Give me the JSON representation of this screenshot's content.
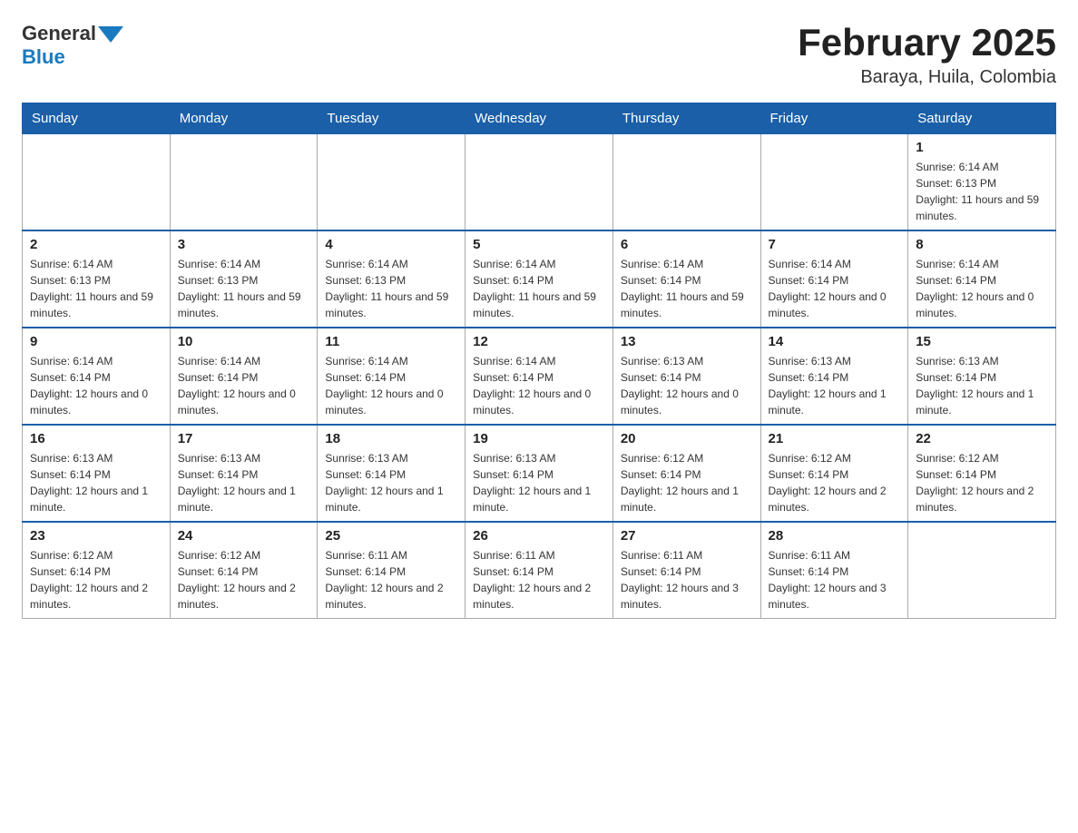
{
  "header": {
    "logo": {
      "general": "General",
      "blue": "Blue"
    },
    "title": "February 2025",
    "location": "Baraya, Huila, Colombia"
  },
  "days_of_week": [
    "Sunday",
    "Monday",
    "Tuesday",
    "Wednesday",
    "Thursday",
    "Friday",
    "Saturday"
  ],
  "weeks": [
    [
      {
        "day": "",
        "info": ""
      },
      {
        "day": "",
        "info": ""
      },
      {
        "day": "",
        "info": ""
      },
      {
        "day": "",
        "info": ""
      },
      {
        "day": "",
        "info": ""
      },
      {
        "day": "",
        "info": ""
      },
      {
        "day": "1",
        "info": "Sunrise: 6:14 AM\nSunset: 6:13 PM\nDaylight: 11 hours and 59 minutes."
      }
    ],
    [
      {
        "day": "2",
        "info": "Sunrise: 6:14 AM\nSunset: 6:13 PM\nDaylight: 11 hours and 59 minutes."
      },
      {
        "day": "3",
        "info": "Sunrise: 6:14 AM\nSunset: 6:13 PM\nDaylight: 11 hours and 59 minutes."
      },
      {
        "day": "4",
        "info": "Sunrise: 6:14 AM\nSunset: 6:13 PM\nDaylight: 11 hours and 59 minutes."
      },
      {
        "day": "5",
        "info": "Sunrise: 6:14 AM\nSunset: 6:14 PM\nDaylight: 11 hours and 59 minutes."
      },
      {
        "day": "6",
        "info": "Sunrise: 6:14 AM\nSunset: 6:14 PM\nDaylight: 11 hours and 59 minutes."
      },
      {
        "day": "7",
        "info": "Sunrise: 6:14 AM\nSunset: 6:14 PM\nDaylight: 12 hours and 0 minutes."
      },
      {
        "day": "8",
        "info": "Sunrise: 6:14 AM\nSunset: 6:14 PM\nDaylight: 12 hours and 0 minutes."
      }
    ],
    [
      {
        "day": "9",
        "info": "Sunrise: 6:14 AM\nSunset: 6:14 PM\nDaylight: 12 hours and 0 minutes."
      },
      {
        "day": "10",
        "info": "Sunrise: 6:14 AM\nSunset: 6:14 PM\nDaylight: 12 hours and 0 minutes."
      },
      {
        "day": "11",
        "info": "Sunrise: 6:14 AM\nSunset: 6:14 PM\nDaylight: 12 hours and 0 minutes."
      },
      {
        "day": "12",
        "info": "Sunrise: 6:14 AM\nSunset: 6:14 PM\nDaylight: 12 hours and 0 minutes."
      },
      {
        "day": "13",
        "info": "Sunrise: 6:13 AM\nSunset: 6:14 PM\nDaylight: 12 hours and 0 minutes."
      },
      {
        "day": "14",
        "info": "Sunrise: 6:13 AM\nSunset: 6:14 PM\nDaylight: 12 hours and 1 minute."
      },
      {
        "day": "15",
        "info": "Sunrise: 6:13 AM\nSunset: 6:14 PM\nDaylight: 12 hours and 1 minute."
      }
    ],
    [
      {
        "day": "16",
        "info": "Sunrise: 6:13 AM\nSunset: 6:14 PM\nDaylight: 12 hours and 1 minute."
      },
      {
        "day": "17",
        "info": "Sunrise: 6:13 AM\nSunset: 6:14 PM\nDaylight: 12 hours and 1 minute."
      },
      {
        "day": "18",
        "info": "Sunrise: 6:13 AM\nSunset: 6:14 PM\nDaylight: 12 hours and 1 minute."
      },
      {
        "day": "19",
        "info": "Sunrise: 6:13 AM\nSunset: 6:14 PM\nDaylight: 12 hours and 1 minute."
      },
      {
        "day": "20",
        "info": "Sunrise: 6:12 AM\nSunset: 6:14 PM\nDaylight: 12 hours and 1 minute."
      },
      {
        "day": "21",
        "info": "Sunrise: 6:12 AM\nSunset: 6:14 PM\nDaylight: 12 hours and 2 minutes."
      },
      {
        "day": "22",
        "info": "Sunrise: 6:12 AM\nSunset: 6:14 PM\nDaylight: 12 hours and 2 minutes."
      }
    ],
    [
      {
        "day": "23",
        "info": "Sunrise: 6:12 AM\nSunset: 6:14 PM\nDaylight: 12 hours and 2 minutes."
      },
      {
        "day": "24",
        "info": "Sunrise: 6:12 AM\nSunset: 6:14 PM\nDaylight: 12 hours and 2 minutes."
      },
      {
        "day": "25",
        "info": "Sunrise: 6:11 AM\nSunset: 6:14 PM\nDaylight: 12 hours and 2 minutes."
      },
      {
        "day": "26",
        "info": "Sunrise: 6:11 AM\nSunset: 6:14 PM\nDaylight: 12 hours and 2 minutes."
      },
      {
        "day": "27",
        "info": "Sunrise: 6:11 AM\nSunset: 6:14 PM\nDaylight: 12 hours and 3 minutes."
      },
      {
        "day": "28",
        "info": "Sunrise: 6:11 AM\nSunset: 6:14 PM\nDaylight: 12 hours and 3 minutes."
      },
      {
        "day": "",
        "info": ""
      }
    ]
  ]
}
